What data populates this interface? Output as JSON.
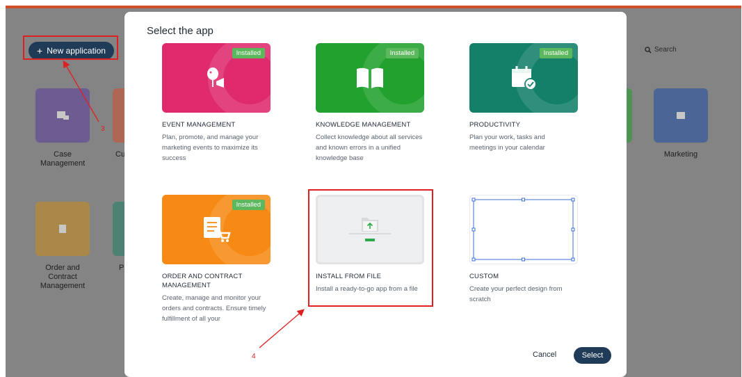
{
  "background": {
    "new_app_label": "New application",
    "search_label": "Search",
    "apps": [
      {
        "label": "Case Management",
        "color": "#5b3d9e"
      },
      {
        "label": "Cu",
        "color": "#d0502c"
      },
      {
        "label": "Marketing",
        "color": "#1d4fa6"
      },
      {
        "label": "Order and Contract Management",
        "color": "#c98d1a"
      },
      {
        "label": "P",
        "color": "#1f8066"
      }
    ],
    "annotations": {
      "step3": "3",
      "step4": "4"
    }
  },
  "modal": {
    "title": "Select the app",
    "installed_label": "Installed",
    "cards": [
      {
        "title": "EVENT MANAGEMENT",
        "desc": "Plan, promote, and manage your marketing events to maximize its success",
        "installed": true,
        "color": "#e02a6e",
        "icon": "balloon-megaphone-icon"
      },
      {
        "title": "KNOWLEDGE MANAGEMENT",
        "desc": "Collect knowledge about all services and known errors in a unified knowledge base",
        "installed": true,
        "color": "#22a12e",
        "icon": "open-book-icon"
      },
      {
        "title": "PRODUCTIVITY",
        "desc": "Plan your work, tasks and meetings in your calendar",
        "installed": true,
        "color": "#14806a",
        "icon": "calendar-check-icon"
      },
      {
        "title": "ORDER AND CONTRACT MANAGEMENT",
        "desc": "Create, manage and monitor your orders and contracts. Ensure timely fulfillment of all your",
        "installed": true,
        "color": "#f68a14",
        "icon": "order-cart-icon"
      },
      {
        "title": "INSTALL FROM FILE",
        "desc": "Install a ready-to-go app from a file",
        "installed": false,
        "color": "#eeeff0",
        "icon": "upload-folder-icon"
      },
      {
        "title": "CUSTOM",
        "desc": "Create your perfect design from scratch",
        "installed": false,
        "color": "#ffffff",
        "icon": "blank-canvas-icon"
      }
    ],
    "cancel_label": "Cancel",
    "select_label": "Select"
  }
}
